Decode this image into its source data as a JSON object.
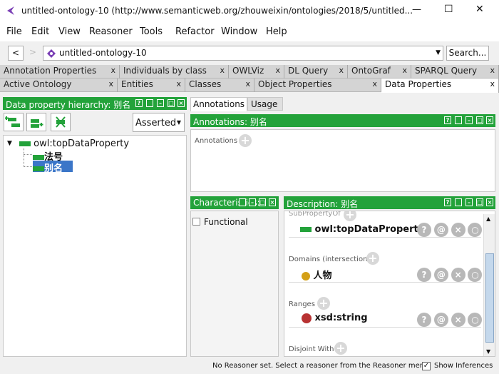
{
  "window": {
    "title": "untitled-ontology-10 (http://www.semanticweb.org/zhouweixin/ontologies/2018/5/untitled...",
    "minimize": "—",
    "maximize": "☐",
    "close": "✕"
  },
  "menu": [
    "File",
    "Edit",
    "View",
    "Reasoner",
    "Tools",
    "Refactor",
    "Window",
    "Help"
  ],
  "nav": {
    "back": "<",
    "forward": ">",
    "ontology": "untitled-ontology-10",
    "search": "Search..."
  },
  "tabs_row1": [
    "Annotation Properties",
    "Individuals by class",
    "OWLViz",
    "DL Query",
    "OntoGraf",
    "SPARQL Query"
  ],
  "tabs_row2": [
    "Active Ontology",
    "Entities",
    "Classes",
    "Object Properties",
    "Data Properties"
  ],
  "tab_close": "x",
  "left": {
    "header": "Data property hierarchy: 别名",
    "asserted": "Asserted",
    "tree": {
      "root": "owl:topDataProperty",
      "children": [
        "法号",
        "别名"
      ]
    }
  },
  "annotations": {
    "tabs": [
      "Annotations",
      "Usage"
    ],
    "header": "Annotations: 别名",
    "label": "Annotations"
  },
  "characteristics": {
    "header": "Characteristics:",
    "functional": "Functional"
  },
  "description": {
    "header": "Description: 别名",
    "sections": [
      {
        "title": "SubPropertyOf",
        "item": "owl:topDataProperty",
        "kind": "property"
      },
      {
        "title": "Domains (intersection)",
        "item": "人物",
        "kind": "class"
      },
      {
        "title": "Ranges",
        "item": "xsd:string",
        "kind": "datatype"
      },
      {
        "title": "Disjoint With",
        "item": "",
        "kind": ""
      }
    ]
  },
  "status": {
    "text": "No Reasoner set. Select a reasoner from the Reasoner menu",
    "show_inferences": "Show Inferences"
  },
  "colors": {
    "green": "#23a23a",
    "class": "#d4a017",
    "datatype": "#b83232",
    "selection": "#3b76c8"
  }
}
